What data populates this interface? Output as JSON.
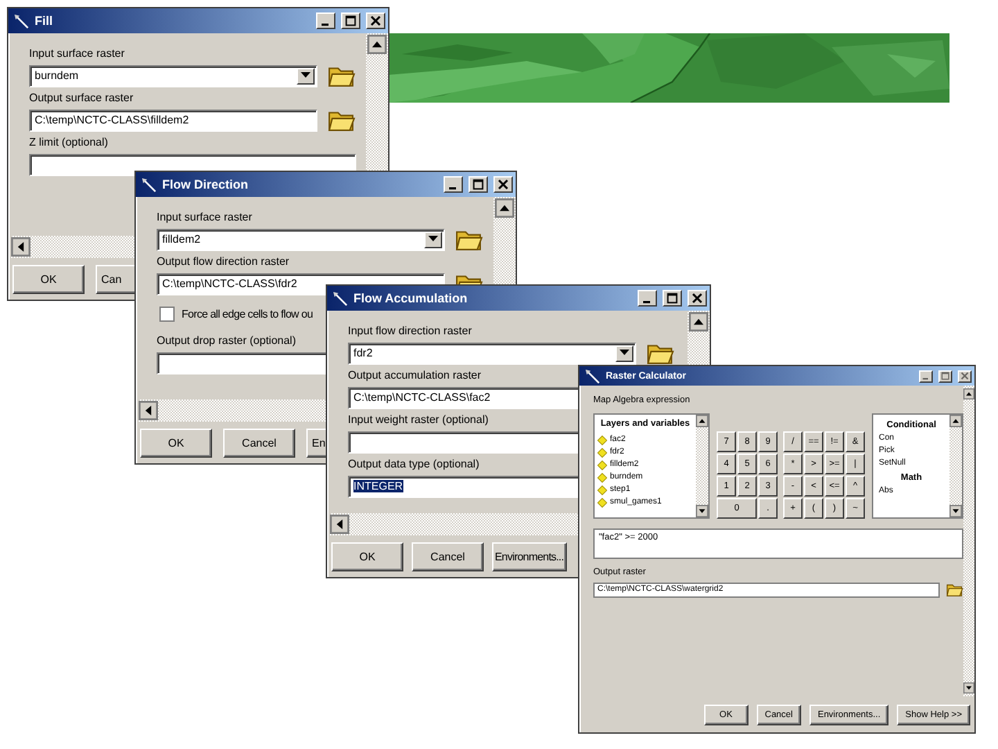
{
  "dialogs": [
    {
      "title": "Fill",
      "fields": [
        {
          "kind": "combo",
          "label": "Input surface raster",
          "value": "burndem",
          "value_selected": false,
          "browse": true
        },
        {
          "kind": "text",
          "label": "Output surface raster",
          "value": "C:\\temp\\NCTC-CLASS\\filldem2",
          "value_selected": false,
          "browse": true
        },
        {
          "kind": "text",
          "label": "Z limit (optional)",
          "browse": false
        }
      ],
      "buttons": [
        "OK",
        "Can"
      ]
    },
    {
      "title": "Flow Direction",
      "fields": [
        {
          "kind": "combo",
          "label": "Input surface raster",
          "value": "filldem2",
          "value_selected": false,
          "browse": true
        },
        {
          "kind": "text",
          "label": "Output flow direction raster",
          "value": "C:\\temp\\NCTC-CLASS\\fdr2",
          "value_selected": false,
          "browse": true
        },
        {
          "kind": "checkbox",
          "label": "Force all edge cells to flow ou",
          "checked": false
        },
        {
          "kind": "text",
          "label": "Output drop raster (optional)",
          "browse": false
        }
      ],
      "buttons": [
        "OK",
        "Cancel",
        "En"
      ]
    },
    {
      "title": "Flow Accumulation",
      "fields": [
        {
          "kind": "combo",
          "label": "Input flow direction raster",
          "value": "fdr2",
          "value_selected": false,
          "browse": true
        },
        {
          "kind": "text",
          "label": "Output accumulation raster",
          "value": "C:\\temp\\NCTC-CLASS\\fac2",
          "value_selected": false,
          "browse": false
        },
        {
          "kind": "text",
          "label": "Input weight raster (optional)",
          "browse": false
        },
        {
          "kind": "text",
          "label": "Output data type (optional)",
          "value": "INTEGER",
          "value_selected": true,
          "browse": false
        }
      ],
      "buttons": [
        "OK",
        "Cancel",
        "Environments..."
      ]
    }
  ],
  "raster_calculator": {
    "title": "Raster Calculator",
    "expression_label": "Map Algebra expression",
    "layers": {
      "header": "Layers and variables",
      "items": [
        "fac2",
        "fdr2",
        "filldem2",
        "burndem",
        "step1",
        "smul_games1"
      ]
    },
    "keypad": {
      "digits": [
        [
          "7",
          "8",
          "9"
        ],
        [
          "4",
          "5",
          "6"
        ],
        [
          "1",
          "2",
          "3"
        ],
        [
          "0",
          "."
        ]
      ],
      "operators": [
        [
          "/",
          "==",
          "!=",
          "&"
        ],
        [
          "*",
          ">",
          ">=",
          "|"
        ],
        [
          "-",
          "<",
          "<=",
          "^"
        ],
        [
          "+",
          "(",
          ")",
          "~"
        ]
      ]
    },
    "functions": [
      {
        "kind": "header",
        "text": "Conditional"
      },
      {
        "kind": "item",
        "text": "Con"
      },
      {
        "kind": "item",
        "text": "Pick"
      },
      {
        "kind": "item",
        "text": "SetNull"
      },
      {
        "kind": "header",
        "text": "Math"
      },
      {
        "kind": "item",
        "text": "Abs"
      }
    ],
    "expression": "\"fac2\" >= 2000",
    "output_label": "Output raster",
    "output_value": "C:\\temp\\NCTC-CLASS\\watergrid2",
    "buttons": [
      "OK",
      "Cancel",
      "Environments...",
      "Show Help >>"
    ]
  }
}
